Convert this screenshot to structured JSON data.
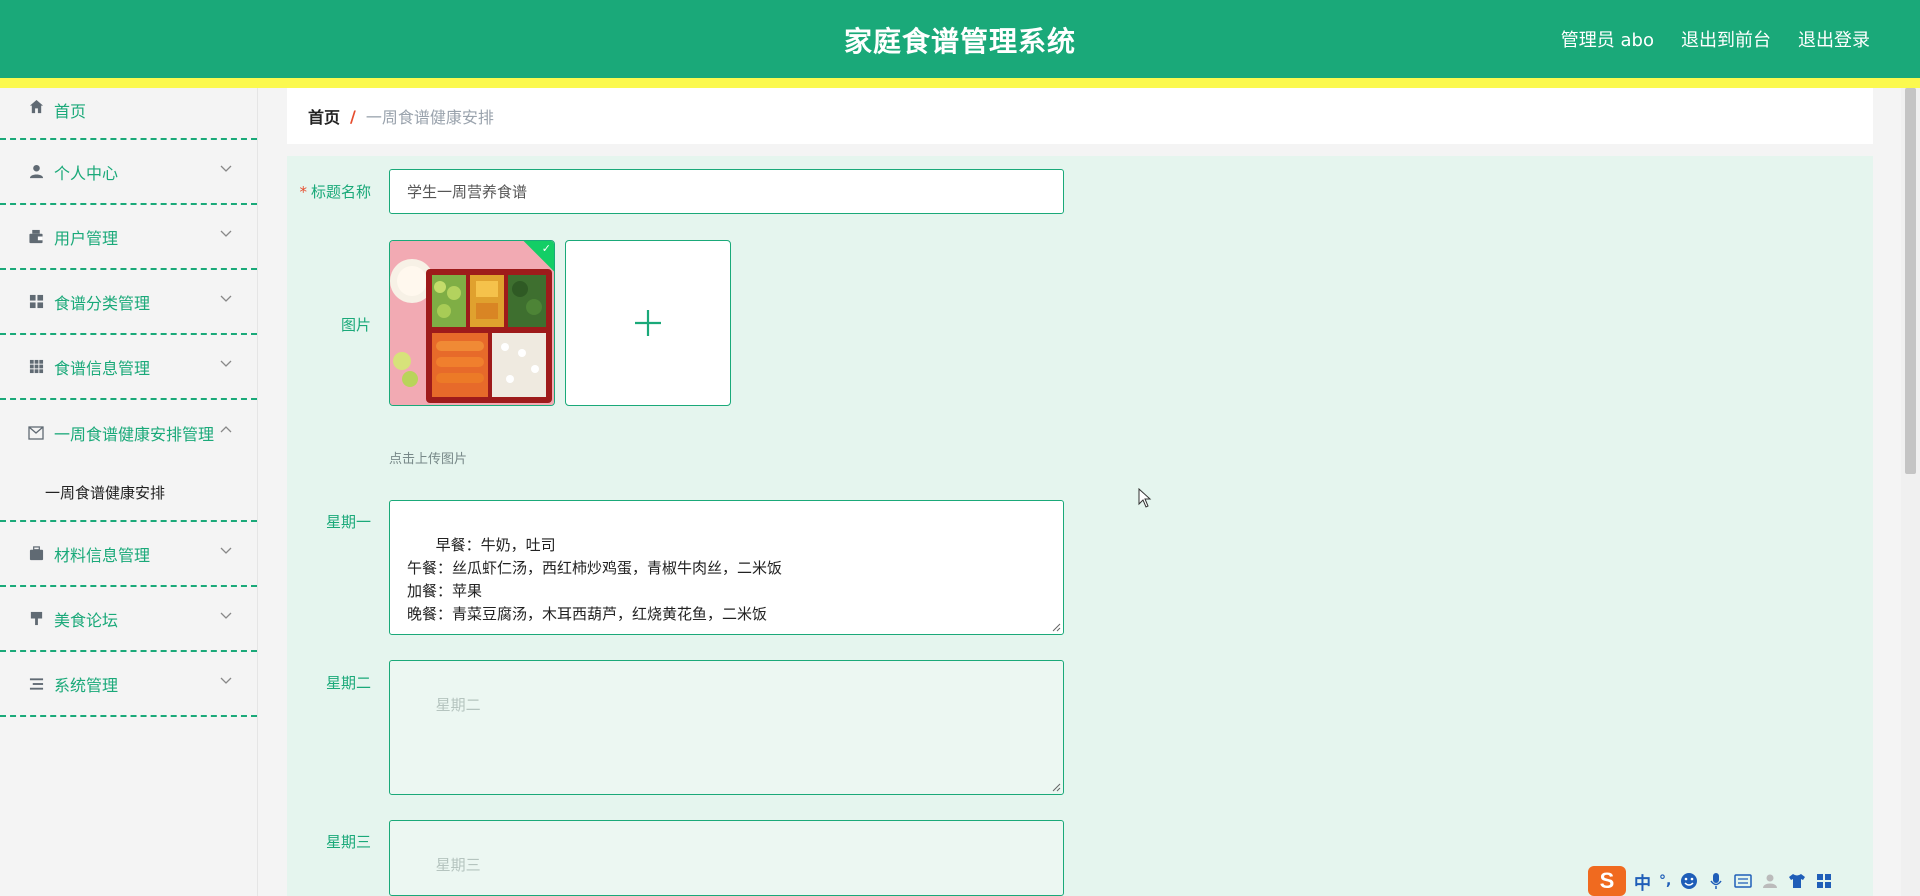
{
  "header": {
    "title": "家庭食谱管理系统",
    "user": "管理员 abo",
    "to_front": "退出到前台",
    "logout": "退出登录"
  },
  "sidebar": {
    "items": [
      {
        "label": "首页",
        "icon": "home-icon"
      },
      {
        "label": "个人中心",
        "icon": "user-icon"
      },
      {
        "label": "用户管理",
        "icon": "wallet-icon"
      },
      {
        "label": "食谱分类管理",
        "icon": "grid-icon"
      },
      {
        "label": "食谱信息管理",
        "icon": "apps-icon"
      },
      {
        "label": "一周食谱健康安排管理",
        "icon": "mail-icon"
      },
      {
        "label": "材料信息管理",
        "icon": "briefcase-icon"
      },
      {
        "label": "美食论坛",
        "icon": "brush-icon"
      },
      {
        "label": "系统管理",
        "icon": "list-icon"
      }
    ],
    "submenu": "一周食谱健康安排"
  },
  "breadcrumb": {
    "home": "首页",
    "separator": "/",
    "current": "一周食谱健康安排"
  },
  "form": {
    "title_label": "标题名称",
    "required_mark": "*",
    "title_value": "学生一周营养食谱",
    "image_label": "图片",
    "upload_hint": "点击上传图片",
    "monday_label": "星期一",
    "monday_value": "早餐：牛奶，吐司\n午餐：丝瓜虾仁汤，西红柿炒鸡蛋，青椒牛肉丝，二米饭\n加餐：苹果\n晚餐：青菜豆腐汤，木耳西葫芦，红烧黄花鱼，二米饭",
    "tuesday_label": "星期二",
    "tuesday_placeholder": "星期二",
    "wednesday_label": "星期三",
    "wednesday_placeholder": "星期三"
  },
  "ime": {
    "logo": "S",
    "mode": "中",
    "punct": "°,"
  },
  "colors": {
    "primary": "#1aa979",
    "accent_bar": "#fbf94e",
    "form_bg": "#e5f5ee",
    "required": "#e64d2e"
  }
}
